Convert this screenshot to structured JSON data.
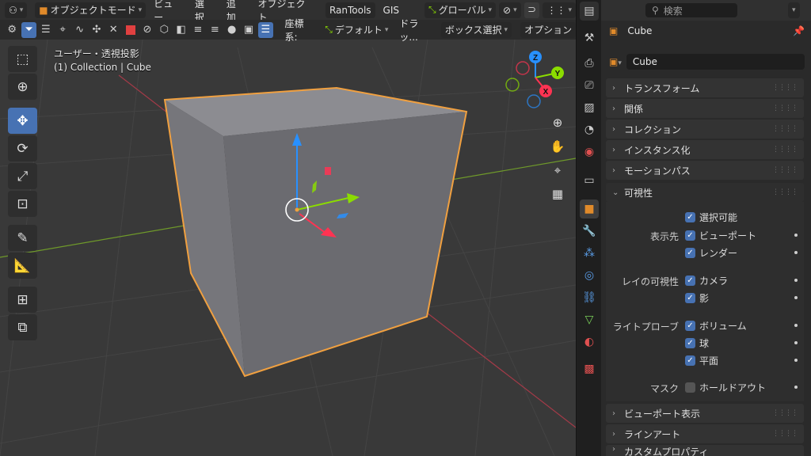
{
  "header": {
    "mode_label": "オブジェクトモード",
    "menus": [
      "ビュー",
      "選択",
      "追加",
      "オブジェクト"
    ],
    "addon_rantools": "RanTools",
    "addon_gis": "GIS",
    "transform_orientation": "グローバル"
  },
  "toolheader": {
    "coord_label": "座標系:",
    "coord_value": "デフォルト",
    "drag_label": "ドラッ...",
    "select_mode": "ボックス選択",
    "options_label": "オプション"
  },
  "viewport": {
    "view_name": "ユーザー・透視投影",
    "collection_info": "(1) Collection | Cube",
    "gizmo": {
      "x": "X",
      "y": "Y",
      "z": "Z"
    }
  },
  "properties": {
    "search_placeholder": "検索",
    "object_title": "Cube",
    "object_name": "Cube",
    "panels_top": [
      "トランスフォーム",
      "関係",
      "コレクション",
      "インスタンス化",
      "モーションパス"
    ],
    "visibility": {
      "title": "可視性",
      "selectable": "選択可能",
      "show_in_label": "表示先",
      "viewport": "ビューポート",
      "render": "レンダー",
      "ray_label": "レイの可視性",
      "camera": "カメラ",
      "shadow": "影",
      "lightprobe_label": "ライトプローブ",
      "volume": "ボリューム",
      "sphere": "球",
      "plane": "平面",
      "mask_label": "マスク",
      "holdout": "ホールドアウト"
    },
    "panels_bottom": [
      "ビューポート表示",
      "ラインアート",
      "カスタムプロパティ"
    ]
  },
  "colors": {
    "accent": "#4772b3",
    "selection_outline": "#f0a040",
    "axis_x": "#ff3352",
    "axis_y": "#8bdc00",
    "axis_z": "#2890ff"
  }
}
